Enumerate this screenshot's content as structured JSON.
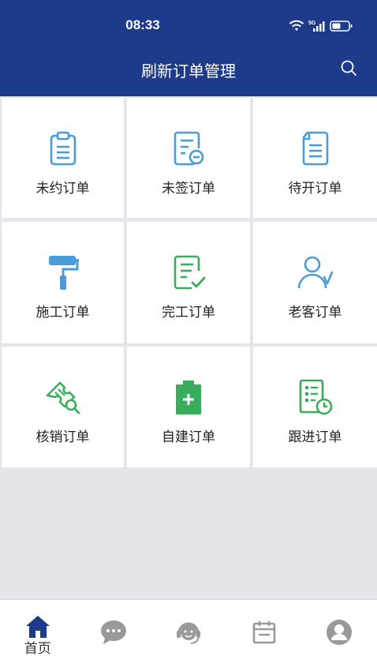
{
  "status_bar": {
    "time": "08:33",
    "network": "5G"
  },
  "header": {
    "title": "刷新订单管理",
    "search_icon": "search-icon"
  },
  "grid": {
    "items": [
      {
        "label": "未约订单",
        "icon": "clipboard-icon",
        "color": "#4a9bd6"
      },
      {
        "label": "未签订单",
        "icon": "document-minus-icon",
        "color": "#4a9bd6"
      },
      {
        "label": "待开订单",
        "icon": "document-icon",
        "color": "#4a9bd6"
      },
      {
        "label": "施工订单",
        "icon": "paint-roller-icon",
        "color": "#4a9bd6"
      },
      {
        "label": "完工订单",
        "icon": "document-check-icon",
        "color": "#3aad5c"
      },
      {
        "label": "老客订单",
        "icon": "user-check-icon",
        "color": "#4a9bd6"
      },
      {
        "label": "核销订单",
        "icon": "ticket-search-icon",
        "color": "#3aad5c"
      },
      {
        "label": "自建订单",
        "icon": "clipboard-plus-icon",
        "color": "#3aad5c"
      },
      {
        "label": "跟进订单",
        "icon": "list-clock-icon",
        "color": "#3aad5c"
      }
    ]
  },
  "tabbar": {
    "tabs": [
      {
        "label": "首页",
        "icon": "home-icon",
        "active": true
      },
      {
        "label": "",
        "icon": "chat-icon",
        "active": false
      },
      {
        "label": "",
        "icon": "headset-icon",
        "active": false
      },
      {
        "label": "",
        "icon": "calendar-icon",
        "active": false
      },
      {
        "label": "",
        "icon": "user-icon",
        "active": false
      }
    ],
    "active_color": "#1e3a8a",
    "inactive_color": "#999999"
  },
  "colors": {
    "header_bg": "#1e3a8a",
    "page_bg": "#e5e6ea",
    "blue_icon": "#4a9bd6",
    "green_icon": "#3aad5c"
  }
}
